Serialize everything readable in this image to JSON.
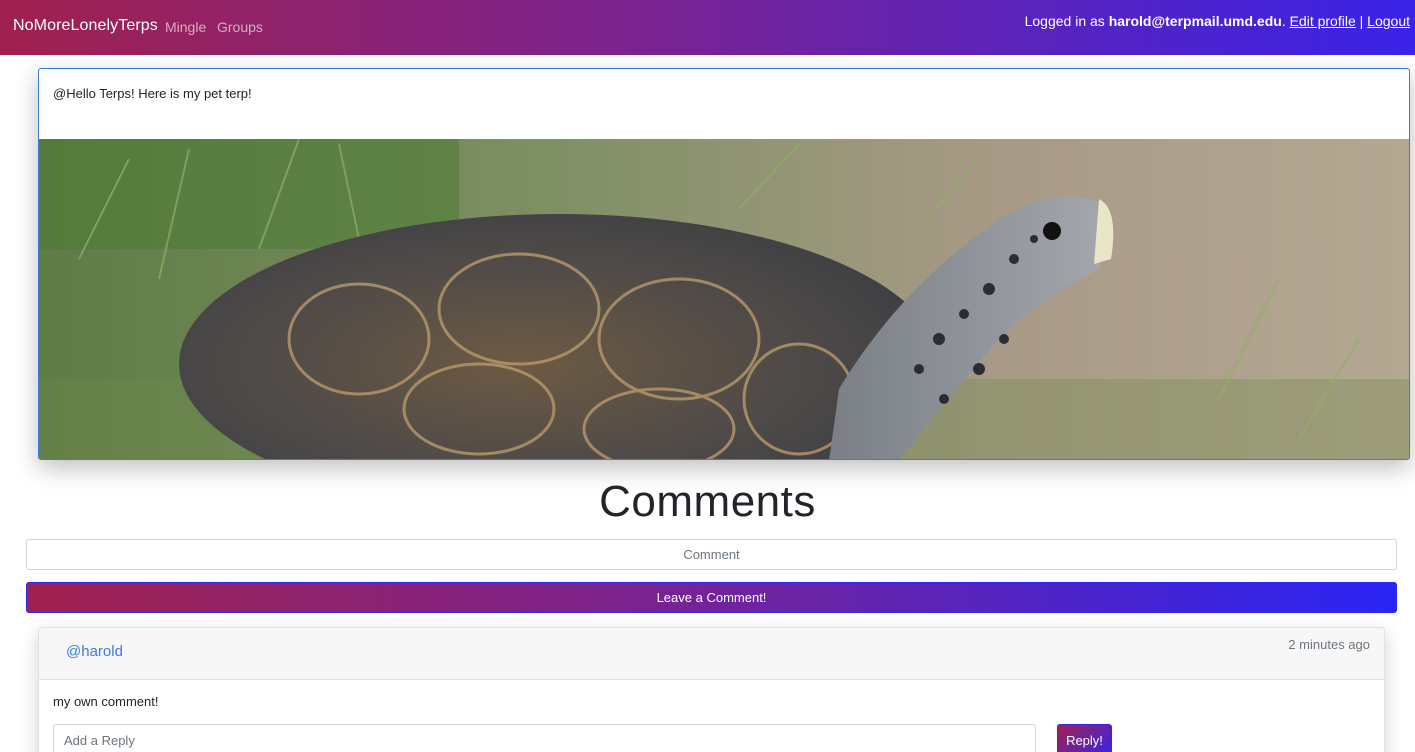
{
  "nav": {
    "brand": "NoMoreLonelyTerps",
    "links": [
      {
        "label": "Mingle"
      },
      {
        "label": "Groups"
      }
    ],
    "user": {
      "prefix": "Logged in as ",
      "email": "harold@terpmail.umd.edu",
      "period": ".",
      "edit_profile": "Edit profile",
      "separator": "|",
      "logout": "Logout"
    }
  },
  "post": {
    "text": "@Hello Terps! Here is my pet terp!",
    "image_alt": "turtle-photo"
  },
  "comments": {
    "heading": "Comments",
    "input_placeholder": "Comment",
    "submit_label": "Leave a Comment!",
    "items": [
      {
        "author": "@harold",
        "time": "2 minutes ago",
        "body": "my own comment!",
        "reply_placeholder": "Add a Reply",
        "reply_label": "Reply!"
      }
    ]
  },
  "colors": {
    "gradient_start": "#a0214e",
    "gradient_end": "#3a23e8",
    "link_blue": "#3b7be0"
  }
}
